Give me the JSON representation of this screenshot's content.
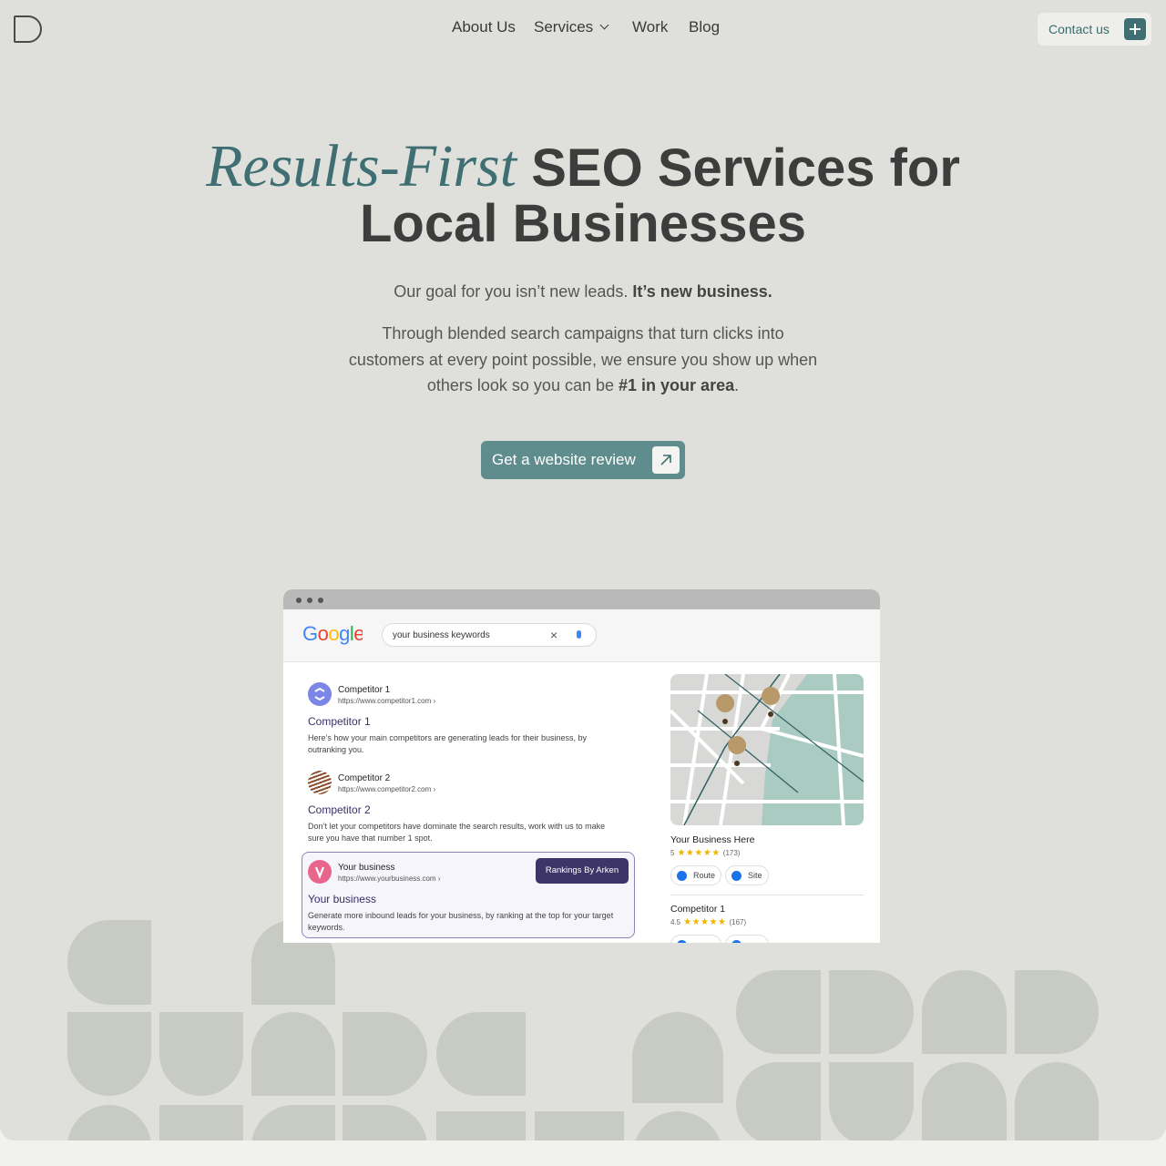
{
  "nav": {
    "items": [
      {
        "label": "About Us"
      },
      {
        "label": "Services"
      },
      {
        "label": "Work"
      },
      {
        "label": "Blog"
      }
    ],
    "contact_label": "Contact us"
  },
  "hero": {
    "title_italic": "Results-First",
    "title_rest_line1": "SEO Services for",
    "title_line2": "Local Businesses",
    "tagline_plain": "Our goal for you isn’t new leads.",
    "tagline_bold": "It’s new business.",
    "desc_plain": "Through blended search campaigns that turn clicks into customers at every point possible, we ensure you show up when others look so you can be",
    "desc_bold": "#1 in your area",
    "desc_end": ".",
    "cta_label": "Get a website review"
  },
  "mockup": {
    "search_query": "your business keywords",
    "google_logo": "Google",
    "results": [
      {
        "name": "Competitor 1",
        "url": "https://www.competitor1.com ›",
        "title": "Competitor 1",
        "desc": "Here’s how your main competitors are generating leads for their business, by outranking you."
      },
      {
        "name": "Competitor 2",
        "url": "https://www.competitor2.com ›",
        "title": "Competitor 2",
        "desc": "Don’t let your competitors have dominate the search results, work with us to make sure you have that number 1 spot."
      },
      {
        "name": "Your business",
        "url": "https://www.yourbusiness.com ›",
        "title": "Your business",
        "desc": "Generate more inbound leads for your business, by ranking at the top for your target keywords."
      }
    ],
    "rank_button": "Rankings By Arken",
    "listings": [
      {
        "name": "Your Business Here",
        "rating": "5",
        "stars": "★★★★★",
        "count": "(173)"
      },
      {
        "name": "Competitor 1",
        "rating": "4.5",
        "stars": "★★★★★",
        "count": "(167)"
      }
    ],
    "route_label": "Route",
    "site_label": "Site"
  },
  "colors": {
    "accent": "#3f6f72",
    "cta": "#5f8c8d",
    "background": "#dfe0dc",
    "rank_button": "#3d3468"
  }
}
